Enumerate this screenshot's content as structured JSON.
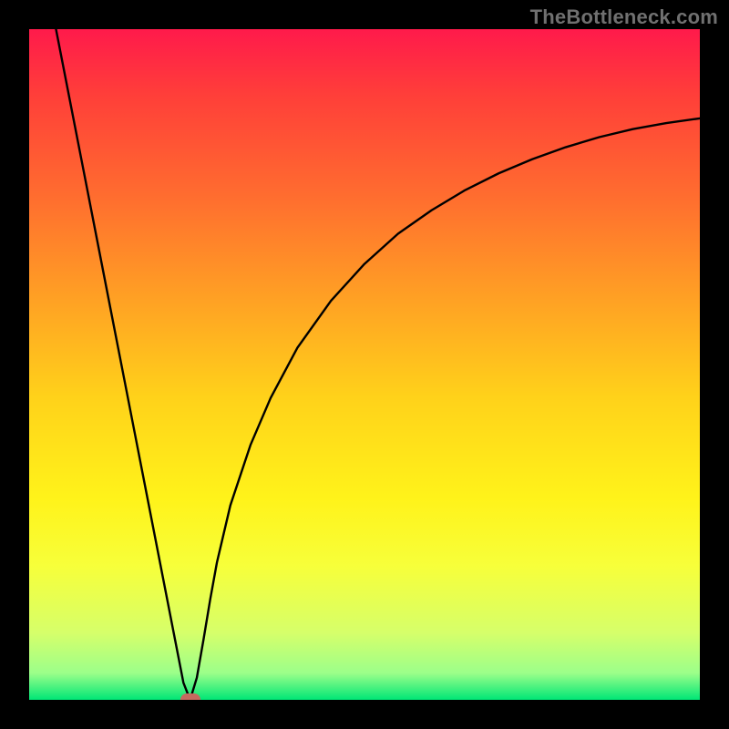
{
  "watermark": {
    "text": "TheBottleneck.com"
  },
  "chart_data": {
    "type": "line",
    "title": "",
    "xlabel": "",
    "ylabel": "",
    "xlim": [
      0,
      100
    ],
    "ylim": [
      0,
      100
    ],
    "grid": false,
    "gradient_stops": [
      {
        "offset": 0.0,
        "color": "#ff1a4b"
      },
      {
        "offset": 0.1,
        "color": "#ff3f39"
      },
      {
        "offset": 0.25,
        "color": "#ff6d2f"
      },
      {
        "offset": 0.4,
        "color": "#ffa024"
      },
      {
        "offset": 0.55,
        "color": "#ffd21a"
      },
      {
        "offset": 0.7,
        "color": "#fff31a"
      },
      {
        "offset": 0.8,
        "color": "#f7ff3a"
      },
      {
        "offset": 0.9,
        "color": "#d6ff6a"
      },
      {
        "offset": 0.96,
        "color": "#9cff8a"
      },
      {
        "offset": 1.0,
        "color": "#00e676"
      }
    ],
    "series": [
      {
        "name": "bottleneck-curve",
        "color": "#000000",
        "x": [
          4.0,
          6.0,
          8.0,
          10.0,
          12.0,
          14.0,
          16.0,
          18.0,
          20.0,
          22.0,
          23.0,
          24.0,
          25.0,
          26.0,
          27.0,
          28.0,
          30.0,
          33.0,
          36.0,
          40.0,
          45.0,
          50.0,
          55.0,
          60.0,
          65.0,
          70.0,
          75.0,
          80.0,
          85.0,
          90.0,
          95.0,
          100.0
        ],
        "y": [
          100.0,
          89.74,
          79.49,
          69.23,
          58.97,
          48.72,
          38.46,
          28.21,
          17.95,
          7.69,
          2.56,
          0.0,
          3.3,
          9.0,
          15.0,
          20.5,
          29.0,
          38.0,
          45.0,
          52.5,
          59.5,
          65.0,
          69.5,
          73.0,
          76.0,
          78.5,
          80.6,
          82.4,
          83.9,
          85.1,
          86.0,
          86.7
        ]
      }
    ],
    "marker": {
      "x": 24.0,
      "y": 0.0,
      "color": "#c56a5f"
    }
  }
}
